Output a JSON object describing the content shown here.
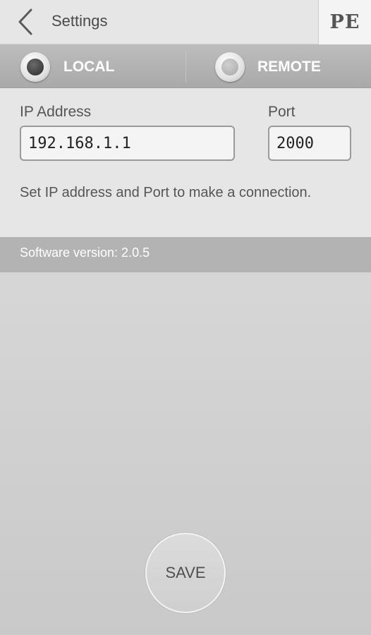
{
  "header": {
    "title": "Settings",
    "back_icon": "chevron-left-icon",
    "logo_text": "PE"
  },
  "mode": {
    "options": [
      {
        "label": "LOCAL",
        "selected": true
      },
      {
        "label": "REMOTE",
        "selected": false
      }
    ]
  },
  "connection": {
    "ip_label": "IP Address",
    "ip_value": "192.168.1.1",
    "port_label": "Port",
    "port_value": "2000",
    "hint": "Set IP address and Port to make a connection."
  },
  "version": {
    "text": "Software version: 2.0.5"
  },
  "actions": {
    "save_label": "SAVE"
  },
  "colors": {
    "header_bg": "#e6e6e6",
    "modebar_bg": "#b0b0b0",
    "versionbar_bg": "#b3b3b3",
    "selected_dot": "#2f2f2f"
  }
}
